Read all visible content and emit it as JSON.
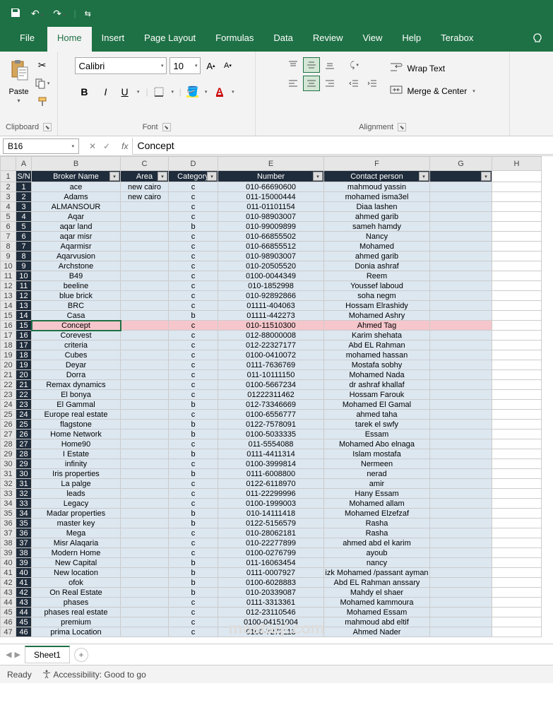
{
  "chart_data": {
    "type": "table",
    "headers": [
      "S/N",
      "Broker Name",
      "Area",
      "Category",
      "Number",
      "Contact person",
      ""
    ],
    "rows": [
      [
        1,
        "ace",
        "new cairo",
        "c",
        "010-66690600",
        "mahmoud yassin",
        ""
      ],
      [
        2,
        "Adams",
        "new cairo",
        "c",
        "011-15000444",
        "mohamed isma3el",
        ""
      ],
      [
        3,
        "ALMANSOUR",
        "",
        "c",
        "011-01101154",
        "Diaa lashen",
        ""
      ],
      [
        4,
        "Aqar",
        "",
        "c",
        "010-98903007",
        "ahmed garib",
        ""
      ],
      [
        5,
        "aqar land",
        "",
        "b",
        "010-99009899",
        "sameh hamdy",
        ""
      ],
      [
        6,
        "aqar misr",
        "",
        "c",
        "010-66855502",
        "Nancy",
        ""
      ],
      [
        7,
        "Aqarmisr",
        "",
        "c",
        "010-66855512",
        "Mohamed",
        ""
      ],
      [
        8,
        "Aqarvusion",
        "",
        "c",
        "010-98903007",
        "ahmed garib",
        ""
      ],
      [
        9,
        "Archstone",
        "",
        "c",
        "010-20505520",
        "Donia ashraf",
        ""
      ],
      [
        10,
        "B49",
        "",
        "c",
        "0100-0044349",
        "Reem",
        ""
      ],
      [
        11,
        "beeline",
        "",
        "c",
        "010-1852998",
        "Youssef laboud",
        ""
      ],
      [
        12,
        "blue brick",
        "",
        "c",
        "010-92892866",
        "soha negm",
        ""
      ],
      [
        13,
        "BRC",
        "",
        "c",
        "01111-404063",
        "Hossam Elrashidy",
        ""
      ],
      [
        14,
        "Casa",
        "",
        "b",
        "01111-442273",
        "Mohamed Ashry",
        ""
      ],
      [
        15,
        "Concept",
        "",
        "c",
        "010-11510300",
        "Ahmed Tag",
        ""
      ],
      [
        16,
        "Corevest",
        "",
        "c",
        "012-88000008",
        "Karim shehata",
        ""
      ],
      [
        17,
        "criteria",
        "",
        "c",
        "012-22327177",
        "Abd EL Rahman",
        ""
      ],
      [
        18,
        "Cubes",
        "",
        "c",
        "0100-0410072",
        "mohamed hassan",
        ""
      ],
      [
        19,
        "Deyar",
        "",
        "c",
        "0111-7636769",
        "Mostafa sobhy",
        ""
      ],
      [
        20,
        "Dorra",
        "",
        "c",
        "011-10111150",
        "Mohamed Nada",
        ""
      ],
      [
        21,
        "Remax dynamics",
        "",
        "c",
        "0100-5667234",
        "dr ashraf khallaf",
        ""
      ],
      [
        22,
        "El bonya",
        "",
        "c",
        "01222311462",
        "Hossam Farouk",
        ""
      ],
      [
        23,
        "El Gammal",
        "",
        "b",
        "012-73346669",
        "Mohamed El Gamal",
        ""
      ],
      [
        24,
        "Europe real estate",
        "",
        "c",
        "0100-6556777",
        "ahmed taha",
        ""
      ],
      [
        25,
        "flagstone",
        "",
        "b",
        "0122-7578091",
        "tarek el swfy",
        ""
      ],
      [
        26,
        "Home Network",
        "",
        "b",
        "0100-5033335",
        "Essam",
        ""
      ],
      [
        27,
        "Home90",
        "",
        "c",
        "011-5554088",
        "Mohamed Abo elnaga",
        ""
      ],
      [
        28,
        "I Estate",
        "",
        "b",
        "0111-4411314",
        "Islam mostafa",
        ""
      ],
      [
        29,
        "infinity",
        "",
        "c",
        "0100-3999814",
        "Nermeen",
        ""
      ],
      [
        30,
        "Iris properties",
        "",
        "b",
        "0111-6008800",
        "nerad",
        ""
      ],
      [
        31,
        "La palge",
        "",
        "c",
        "0122-6118970",
        "amir",
        ""
      ],
      [
        32,
        "leads",
        "",
        "c",
        "011-22299996",
        "Hany Essam",
        ""
      ],
      [
        33,
        "Legacy",
        "",
        "c",
        "0100-1999003",
        "Mohamed allam",
        ""
      ],
      [
        34,
        "Madar properties",
        "",
        "b",
        "010-14111418",
        "Mohamed Elzefzaf",
        ""
      ],
      [
        35,
        "master key",
        "",
        "b",
        "0122-5156579",
        "Rasha",
        ""
      ],
      [
        36,
        "Mega",
        "",
        "c",
        "010-28062181",
        "Rasha",
        ""
      ],
      [
        37,
        "Misr Alaqaria",
        "",
        "c",
        "010-22277899",
        "ahmed abd el karim",
        ""
      ],
      [
        38,
        "Modern Home",
        "",
        "c",
        "0100-0276799",
        "ayoub",
        ""
      ],
      [
        39,
        "New Capital",
        "",
        "b",
        "011-16063454",
        "nancy",
        ""
      ],
      [
        40,
        "New location",
        "",
        "b",
        "0111-0007927",
        "izk Mohamed /passant ayman",
        ""
      ],
      [
        41,
        "ofok",
        "",
        "b",
        "0100-6028883",
        "Abd EL Rahman anssary",
        ""
      ],
      [
        42,
        "On Real Estate",
        "",
        "b",
        "010-20339087",
        "Mahdy el shaer",
        ""
      ],
      [
        43,
        "phases",
        "",
        "c",
        "0111-3313361",
        "Mohamed kammoura",
        ""
      ],
      [
        44,
        "phases real estate",
        "",
        "c",
        "012-23110546",
        "Mohamed Essam",
        ""
      ],
      [
        45,
        "premium",
        "",
        "c",
        "0100-04151004",
        "mahmoud abd eltif",
        ""
      ],
      [
        46,
        "prima Location",
        "",
        "c",
        "0100-7272113",
        "Ahmed Nader",
        ""
      ]
    ]
  },
  "tabs": {
    "file": "File",
    "home": "Home",
    "insert": "Insert",
    "pageLayout": "Page Layout",
    "formulas": "Formulas",
    "data": "Data",
    "review": "Review",
    "view": "View",
    "help": "Help",
    "terabox": "Terabox"
  },
  "ribbon": {
    "clipboard": {
      "paste": "Paste",
      "label": "Clipboard"
    },
    "font": {
      "name": "Calibri",
      "size": "10",
      "label": "Font"
    },
    "alignment": {
      "wrapText": "Wrap Text",
      "mergeCenter": "Merge & Center",
      "label": "Alignment"
    }
  },
  "nameBox": "B16",
  "formulaBar": "Concept",
  "activeCell": {
    "row": 16,
    "col": 2
  },
  "highlightRow": 16,
  "columns": [
    "A",
    "B",
    "C",
    "D",
    "E",
    "F",
    "G",
    "H"
  ],
  "sheetTab": "Sheet1",
  "status": {
    "ready": "Ready",
    "accessibility": "Accessibility: Good to go"
  },
  "watermark": "mostaql.com"
}
